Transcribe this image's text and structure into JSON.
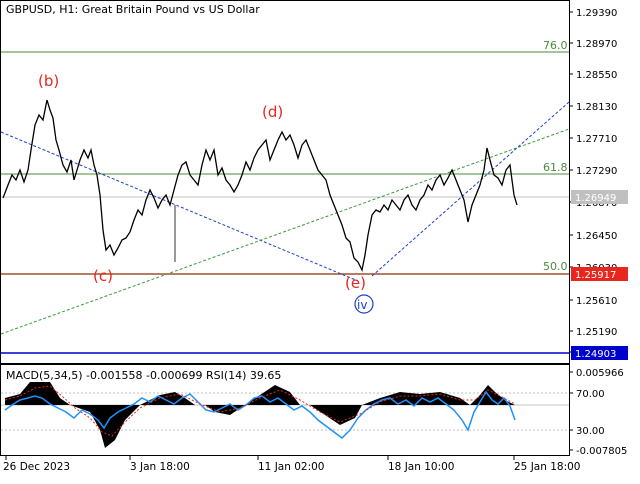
{
  "header": {
    "symbol": "GBPUSD, H1:",
    "description": "Great Britain Pound vs US Dollar"
  },
  "price_axis": {
    "ticks": [
      "1.29390",
      "1.28970",
      "1.28550",
      "1.28130",
      "1.27710",
      "1.27290",
      "1.26870",
      "1.26450",
      "1.26030",
      "1.25610",
      "1.25190",
      "1.24770"
    ]
  },
  "current_price": "1.26949",
  "levels": {
    "fib_76": "76.0",
    "fib_61": "61.8",
    "fib_50": "50.0",
    "red_level": "1.25917",
    "blue_level": "1.24903"
  },
  "wave_labels": {
    "b": "(b)",
    "c": "(c)",
    "d": "(d)",
    "e": "(e)",
    "iv": "iv"
  },
  "indicator": {
    "title": "MACD(5,34,5) -0.001558 -0.000699 RSI(14) 39.65",
    "ticks": [
      "0.005966",
      "70.00",
      "30.00",
      "-0.007805"
    ]
  },
  "time_axis": {
    "ticks": [
      "26 Dec 2023",
      "3 Jan 18:00",
      "11 Jan 02:00",
      "18 Jan 10:00",
      "25 Jan 18:00"
    ]
  },
  "colors": {
    "fib_line": "#4a8a3a",
    "red_line": "#a0522d",
    "blue_line": "#0000cc",
    "wave_red": "#e8261e",
    "wave_blue": "#1e3fcc",
    "price_label_gray": "#c0c0c0",
    "price_label_red": "#e8261e",
    "price_label_blue": "#0000cc"
  },
  "icons": {
    "wave_iv_marker": "circle-icon"
  }
}
